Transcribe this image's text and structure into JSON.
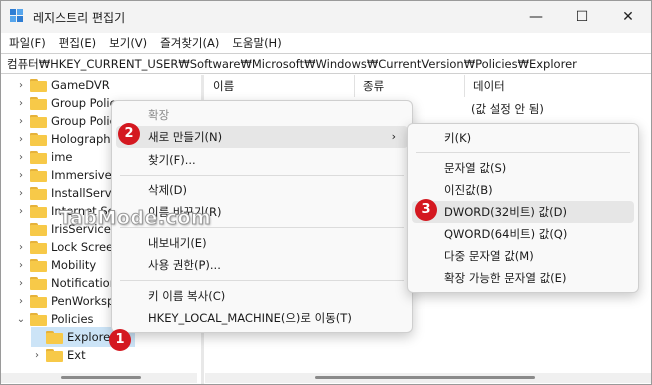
{
  "window": {
    "title": "레지스트리 편집기"
  },
  "titlebar_controls": {
    "minimize": "—",
    "maximize": "☐",
    "close": "✕"
  },
  "menubar": [
    "파일(F)",
    "편집(E)",
    "보기(V)",
    "즐겨찾기(A)",
    "도움말(H)"
  ],
  "address": "컴퓨터₩HKEY_CURRENT_USER₩Software₩Microsoft₩Windows₩CurrentVersion₩Policies₩Explorer",
  "tree": [
    {
      "label": "GameDVR",
      "chev": "›"
    },
    {
      "label": "Group Policy",
      "chev": "›"
    },
    {
      "label": "Group Polic",
      "chev": "›"
    },
    {
      "label": "Holographi",
      "chev": "›"
    },
    {
      "label": "ime",
      "chev": "›"
    },
    {
      "label": "ImmersiveS",
      "chev": "›"
    },
    {
      "label": "InstallServic",
      "chev": "›"
    },
    {
      "label": "Internet Set",
      "chev": "›"
    },
    {
      "label": "IrisService",
      "chev": ""
    },
    {
      "label": "Lock Screen",
      "chev": "›"
    },
    {
      "label": "Mobility",
      "chev": "›"
    },
    {
      "label": "Notification",
      "chev": "›"
    },
    {
      "label": "PenWorksp",
      "chev": "›"
    },
    {
      "label": "Policies",
      "chev": "⌄"
    },
    {
      "label": "Explorer",
      "chev": ""
    },
    {
      "label": "Ext",
      "chev": "›"
    }
  ],
  "columns": {
    "name": "이름",
    "type": "종류",
    "data": "데이터"
  },
  "value_row": {
    "data": "(값 설정 안 됨)"
  },
  "context_menu": {
    "header": "확장",
    "items": [
      "새로 만들기(N)",
      "찾기(F)...",
      "삭제(D)",
      "이름 바꾸기(R)",
      "내보내기(E)",
      "사용 권한(P)...",
      "키 이름 복사(C)",
      "HKEY_LOCAL_MACHINE(으)로 이동(T)"
    ]
  },
  "submenu": {
    "items": [
      "키(K)",
      "문자열 값(S)",
      "이진값(B)",
      "DWORD(32비트) 값(D)",
      "QWORD(64비트) 값(Q)",
      "다중 문자열 값(M)",
      "확장 가능한 문자열 값(E)"
    ]
  },
  "badges": [
    "1",
    "2",
    "3"
  ],
  "watermark": "TabMode.com",
  "colors": {
    "badge": "#d41820",
    "selection": "#cce4f7",
    "folder": "#f7c948"
  }
}
